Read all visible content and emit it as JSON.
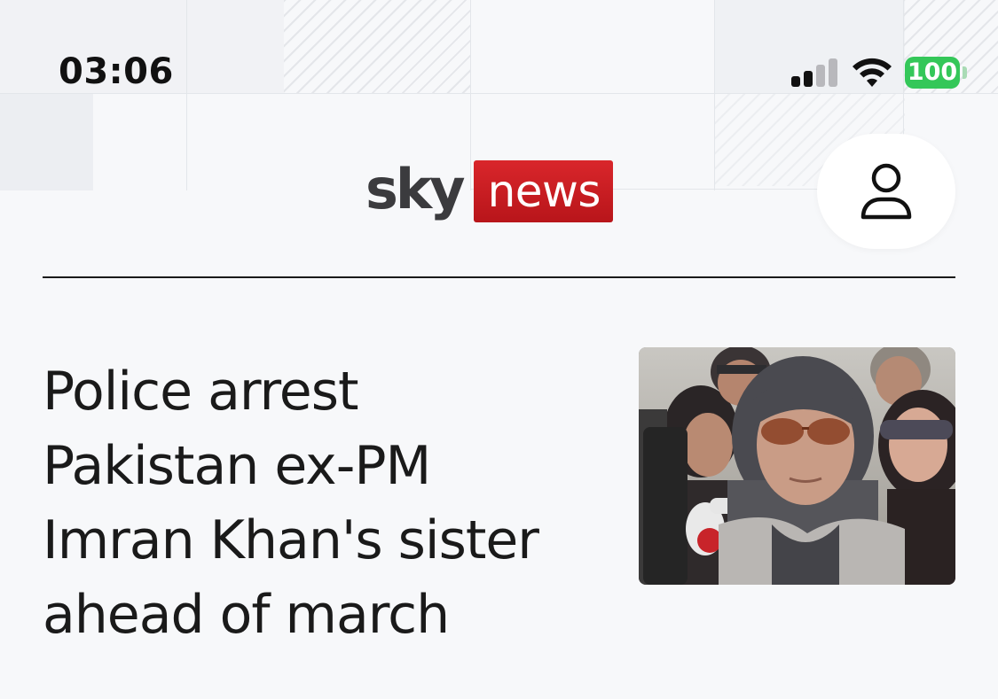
{
  "status_bar": {
    "time": "03:06",
    "battery_level": "100",
    "signal_bars_active": 2,
    "signal_bars_total": 4,
    "battery_color": "#34c759"
  },
  "header": {
    "logo_sky": "sky",
    "logo_news": "news",
    "brand_red": "#c8191f",
    "account_icon": "person-icon"
  },
  "article": {
    "headline_lines": [
      "Police arrest",
      "Pakistan ex-PM",
      "Imran Khan's sister",
      "ahead of march"
    ]
  }
}
